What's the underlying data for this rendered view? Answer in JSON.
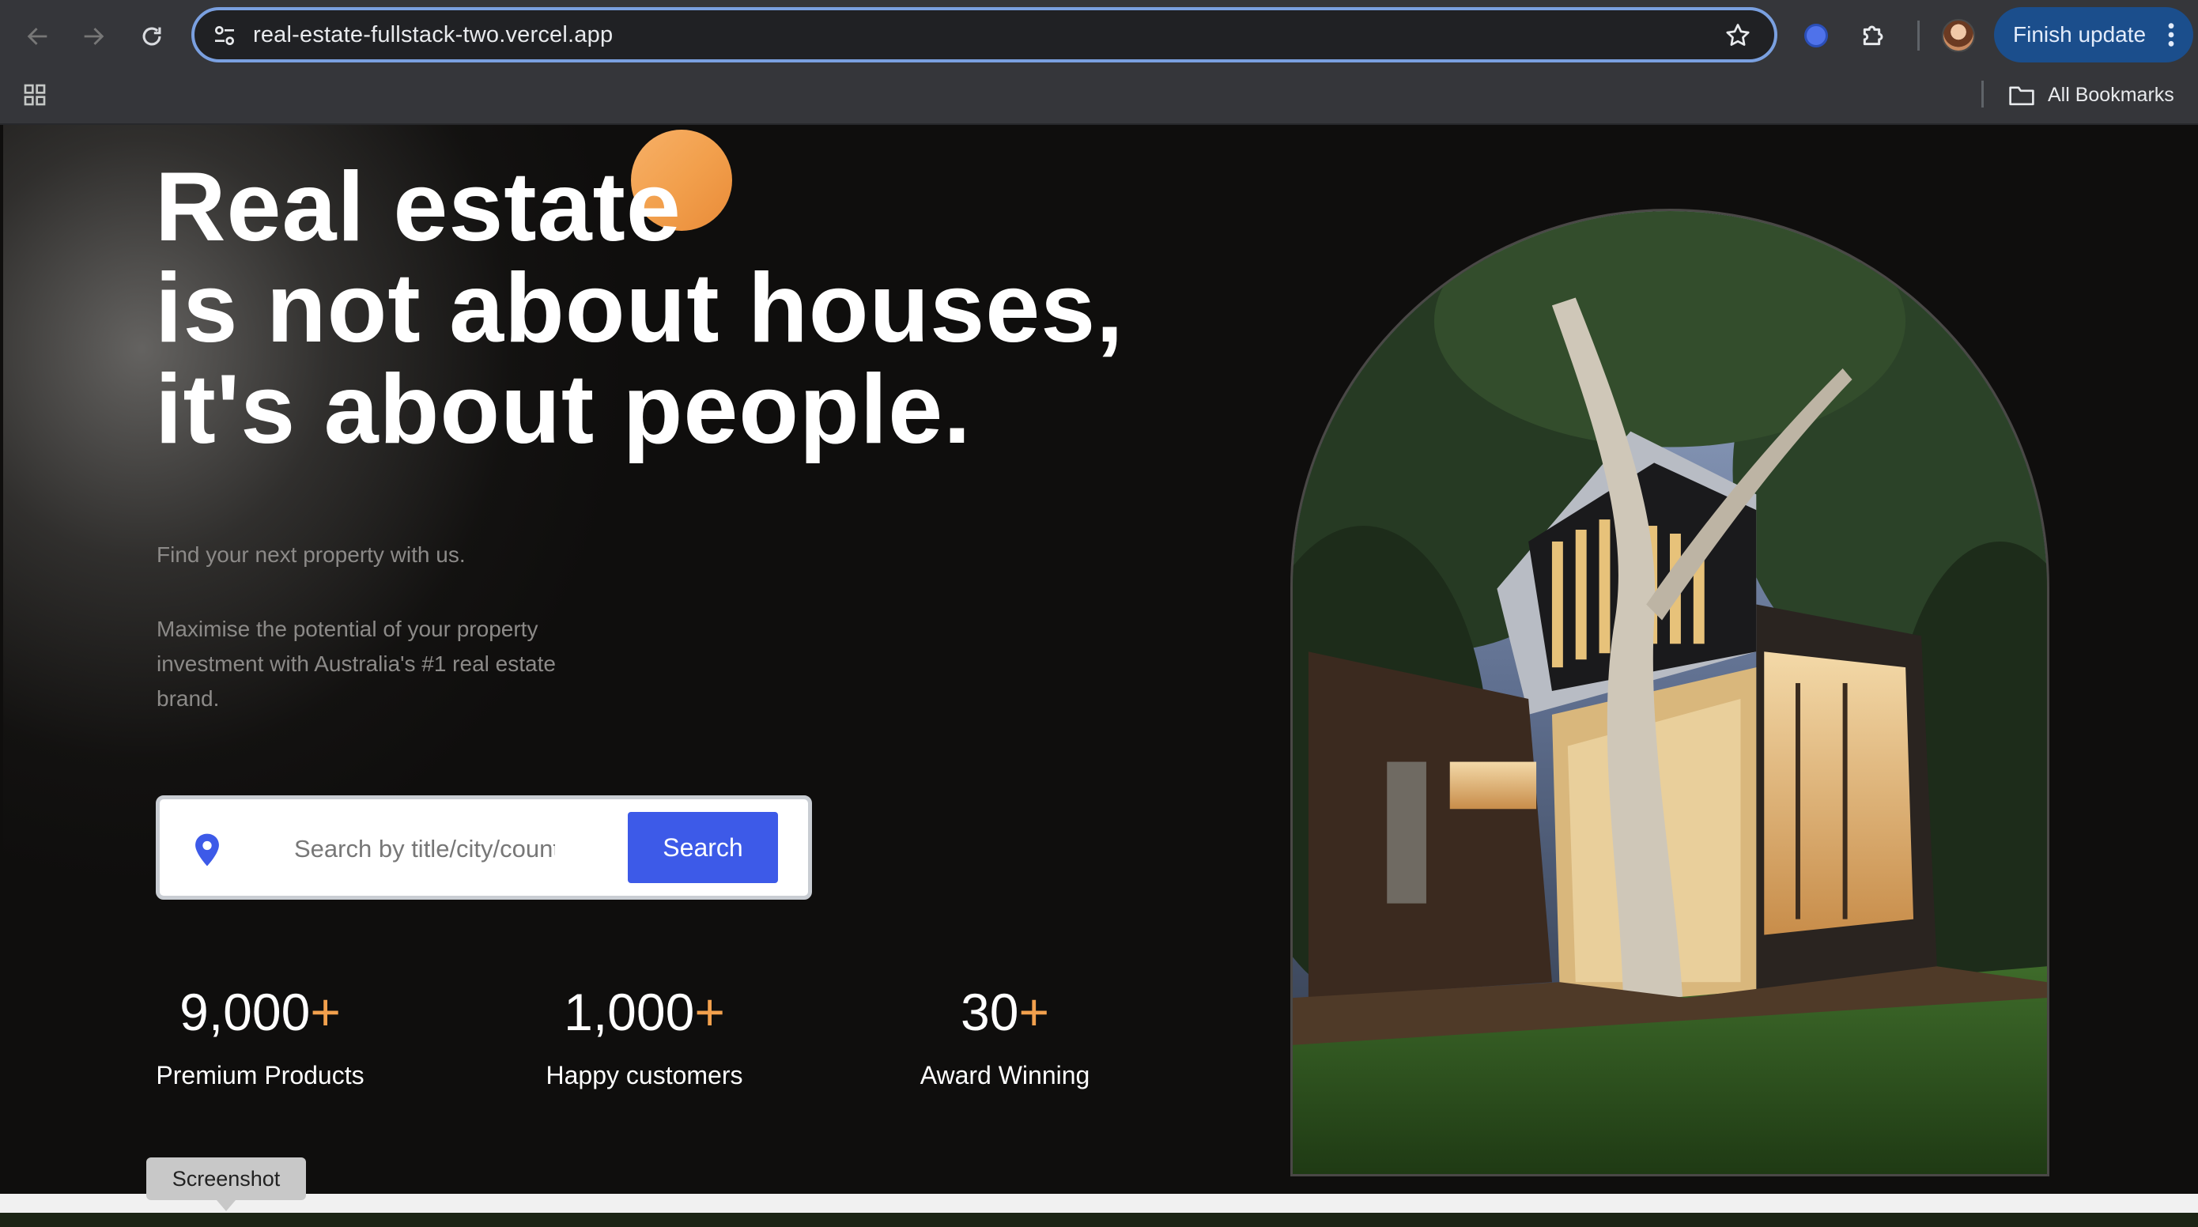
{
  "browser": {
    "url": "real-estate-fullstack-two.vercel.app",
    "finish_update_label": "Finish update",
    "all_bookmarks_label": "All Bookmarks",
    "icons": [
      "back-arrow-icon",
      "forward-arrow-icon",
      "reload-icon",
      "site-info-icon",
      "bookmark-star-icon",
      "extension-icon",
      "puzzle-icon",
      "avatar",
      "kebab-menu-icon",
      "apps-grid-icon",
      "folder-icon"
    ]
  },
  "hero": {
    "title_lines": [
      "Real estate",
      "is not about houses,",
      "it's about people."
    ],
    "subtitle": "Find your next property with us.",
    "description": "Maximise the potential of your property investment with Australia's #1 real estate brand."
  },
  "search": {
    "placeholder": "Search by title/city/country",
    "button_label": "Search",
    "icon": "location-pin-icon"
  },
  "stats": [
    {
      "value": "9,000",
      "suffix": "+",
      "label": "Premium Products"
    },
    {
      "value": "1,000",
      "suffix": "+",
      "label": "Happy customers"
    },
    {
      "value": "30",
      "suffix": "+",
      "label": "Award Winning"
    }
  ],
  "tooltip": {
    "label": "Screenshot"
  },
  "colors": {
    "accent_orange": "#f2a04d",
    "search_button_blue": "#3d5ae8",
    "page_background": "#0f0e0d",
    "browser_toolbar": "#35363a",
    "update_button": "#1b4e8c"
  }
}
